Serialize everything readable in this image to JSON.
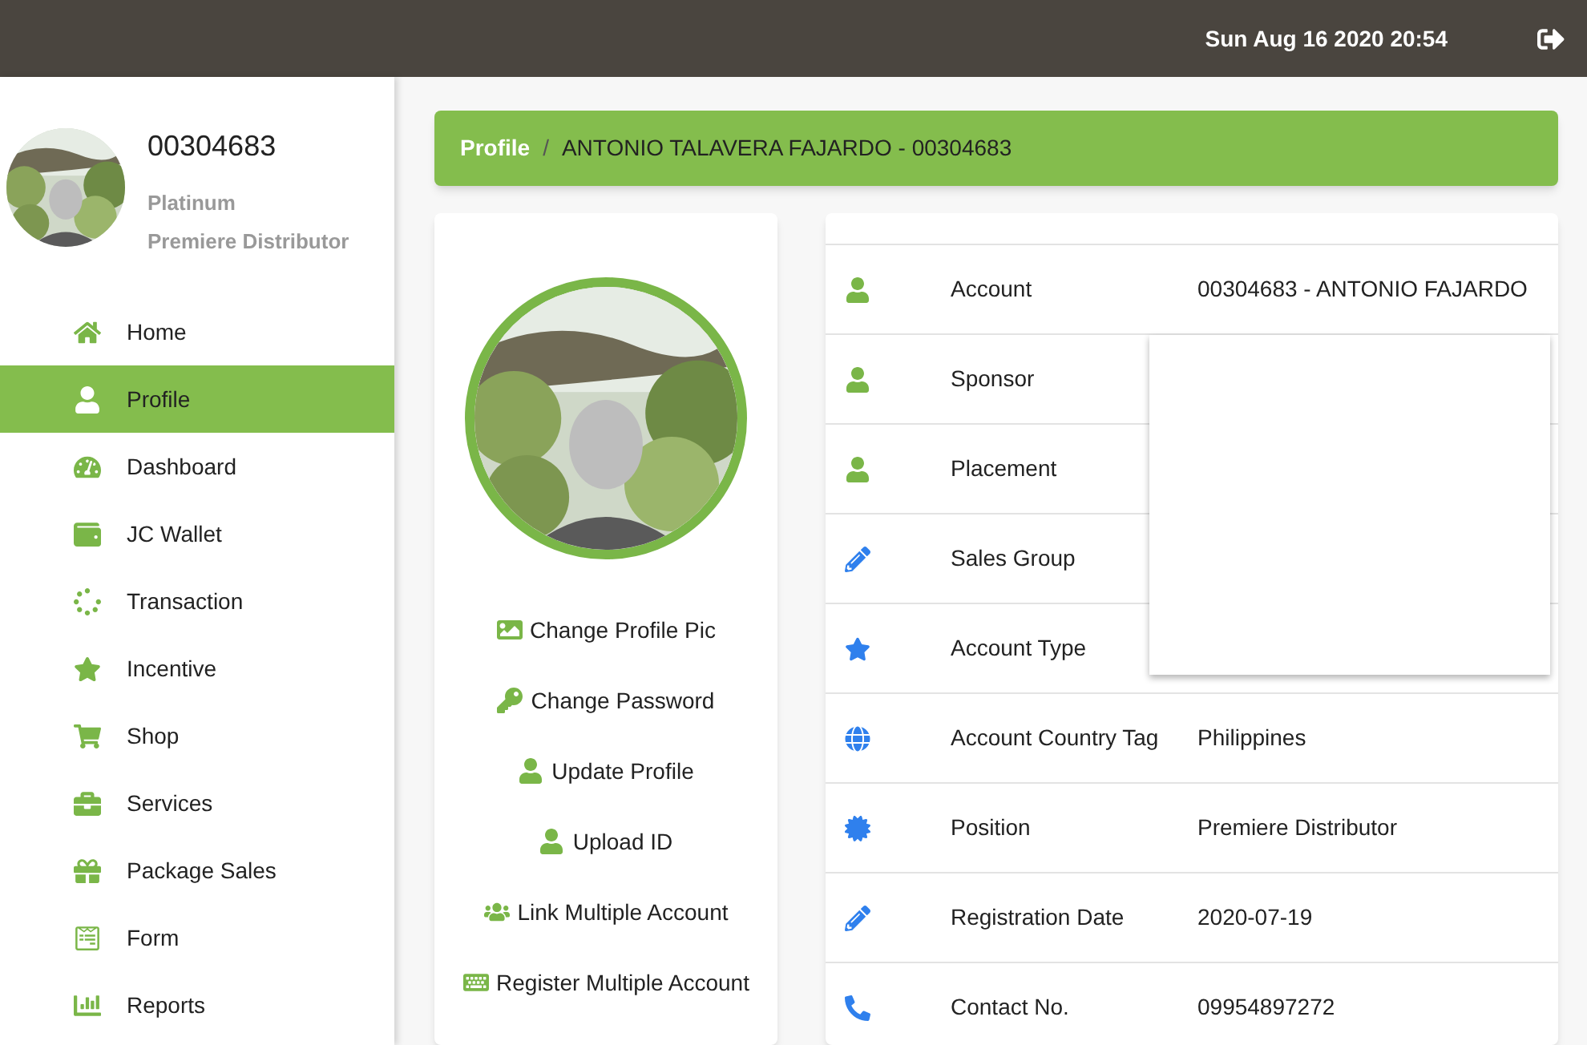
{
  "header": {
    "datetime": "Sun Aug 16 2020 20:54"
  },
  "user": {
    "id": "00304683",
    "rank": "Platinum",
    "title": "Premiere Distributor"
  },
  "sidebar": {
    "items": [
      {
        "label": "Home",
        "selected": false
      },
      {
        "label": "Profile",
        "selected": true
      },
      {
        "label": "Dashboard",
        "selected": false
      },
      {
        "label": "JC Wallet",
        "selected": false
      },
      {
        "label": "Transaction",
        "selected": false
      },
      {
        "label": "Incentive",
        "selected": false
      },
      {
        "label": "Shop",
        "selected": false
      },
      {
        "label": "Services",
        "selected": false
      },
      {
        "label": "Package Sales",
        "selected": false
      },
      {
        "label": "Form",
        "selected": false
      },
      {
        "label": "Reports",
        "selected": false
      }
    ]
  },
  "breadcrumb": {
    "section": "Profile",
    "separator": "/",
    "current": "ANTONIO TALAVERA FAJARDO - 00304683"
  },
  "actions": [
    "Change Profile Pic",
    "Change Password",
    "Update Profile",
    "Upload ID",
    "Link Multiple Account",
    "Register Multiple Account"
  ],
  "details": [
    {
      "label": "Account",
      "value": "00304683 - ANTONIO FAJARDO"
    },
    {
      "label": "Sponsor"
    },
    {
      "label": "Placement"
    },
    {
      "label": "Sales Group"
    },
    {
      "label": "Account Type"
    },
    {
      "label": "Account Country Tag",
      "value": "Philippines"
    },
    {
      "label": "Position",
      "value": "Premiere Distributor"
    },
    {
      "label": "Registration Date",
      "value": "2020-07-19"
    },
    {
      "label": "Contact No.",
      "value": "09954897272"
    }
  ],
  "popup": {
    "open": true
  }
}
